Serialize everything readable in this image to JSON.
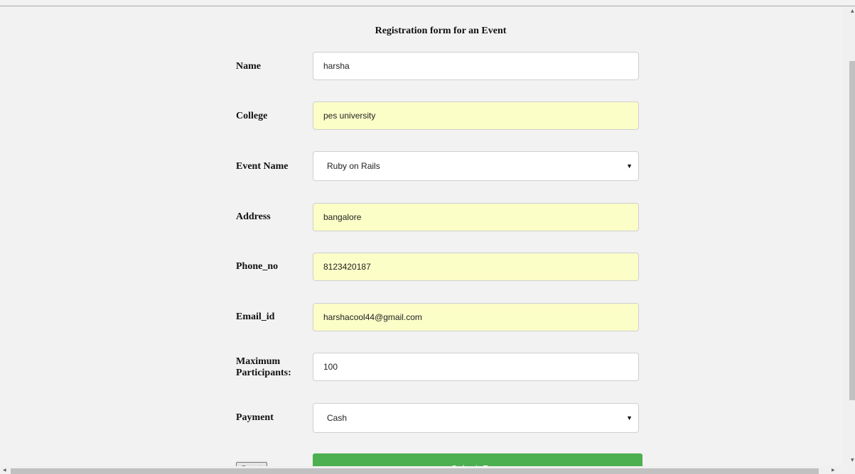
{
  "form": {
    "title": "Registration form for an Event",
    "fields": {
      "name": {
        "label": "Name",
        "value": "harsha"
      },
      "college": {
        "label": "College",
        "value": "pes university"
      },
      "event": {
        "label": "Event Name",
        "value": "Ruby on Rails"
      },
      "address": {
        "label": "Address",
        "value": "bangalore"
      },
      "phone": {
        "label": "Phone_no",
        "value": "8123420187"
      },
      "email": {
        "label": "Email_id",
        "value": "harshacool44@gmail.com"
      },
      "max": {
        "label_line1": "Maximum",
        "label_line2": "Participants:",
        "value": "100"
      },
      "payment": {
        "label": "Payment",
        "value": "Cash"
      }
    },
    "buttons": {
      "reset": "Reset",
      "submit": "Submit Form"
    }
  },
  "icons": {
    "dropdown": "caret-down-icon"
  },
  "colors": {
    "submit": "#4caf50",
    "autofill": "#fbffc7",
    "background": "#f2f2f2"
  }
}
